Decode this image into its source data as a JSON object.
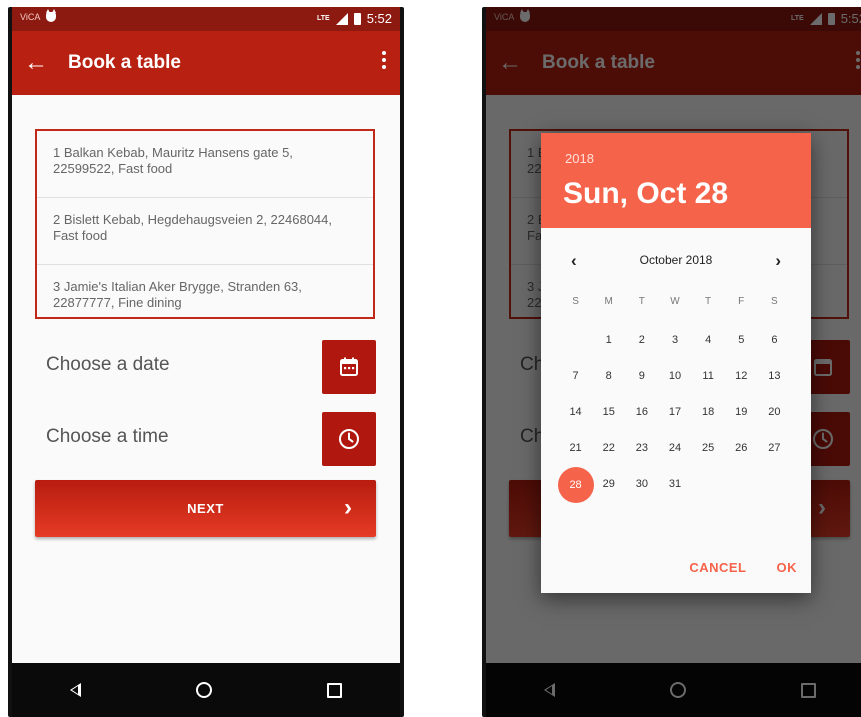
{
  "status_bar": {
    "carrier": "ViCA",
    "network": "LTE",
    "time": "5:52"
  },
  "app_bar": {
    "title": "Book a table"
  },
  "restaurants": [
    {
      "text": "1 Balkan Kebab, Mauritz Hansens gate 5, 22599522, Fast food"
    },
    {
      "text": "2 Bislett Kebab, Hegdehaugsveien 2, 22468044, Fast food"
    },
    {
      "text": "3 Jamie's Italian Aker Brygge, Stranden 63, 22877777, Fine dining"
    }
  ],
  "date_chooser": {
    "label": "Choose a date",
    "icon": "calendar-icon"
  },
  "time_chooser": {
    "label": "Choose a time",
    "icon": "clock-icon"
  },
  "next_button": {
    "label": "NEXT",
    "icon": "chevron-right-icon"
  },
  "date_picker": {
    "year": "2018",
    "selected_date": "Sun, Oct 28",
    "month_label": "October 2018",
    "weekdays": [
      "S",
      "M",
      "T",
      "W",
      "T",
      "F",
      "S"
    ],
    "first_weekday_index": 1,
    "days_in_month": 31,
    "selected_day": 28,
    "cancel_label": "CANCEL",
    "ok_label": "OK"
  },
  "colors": {
    "status_bar": "#8c1a10",
    "app_bar": "#b82112",
    "accent_button": "#b0180f",
    "picker_accent": "#f5634a"
  }
}
